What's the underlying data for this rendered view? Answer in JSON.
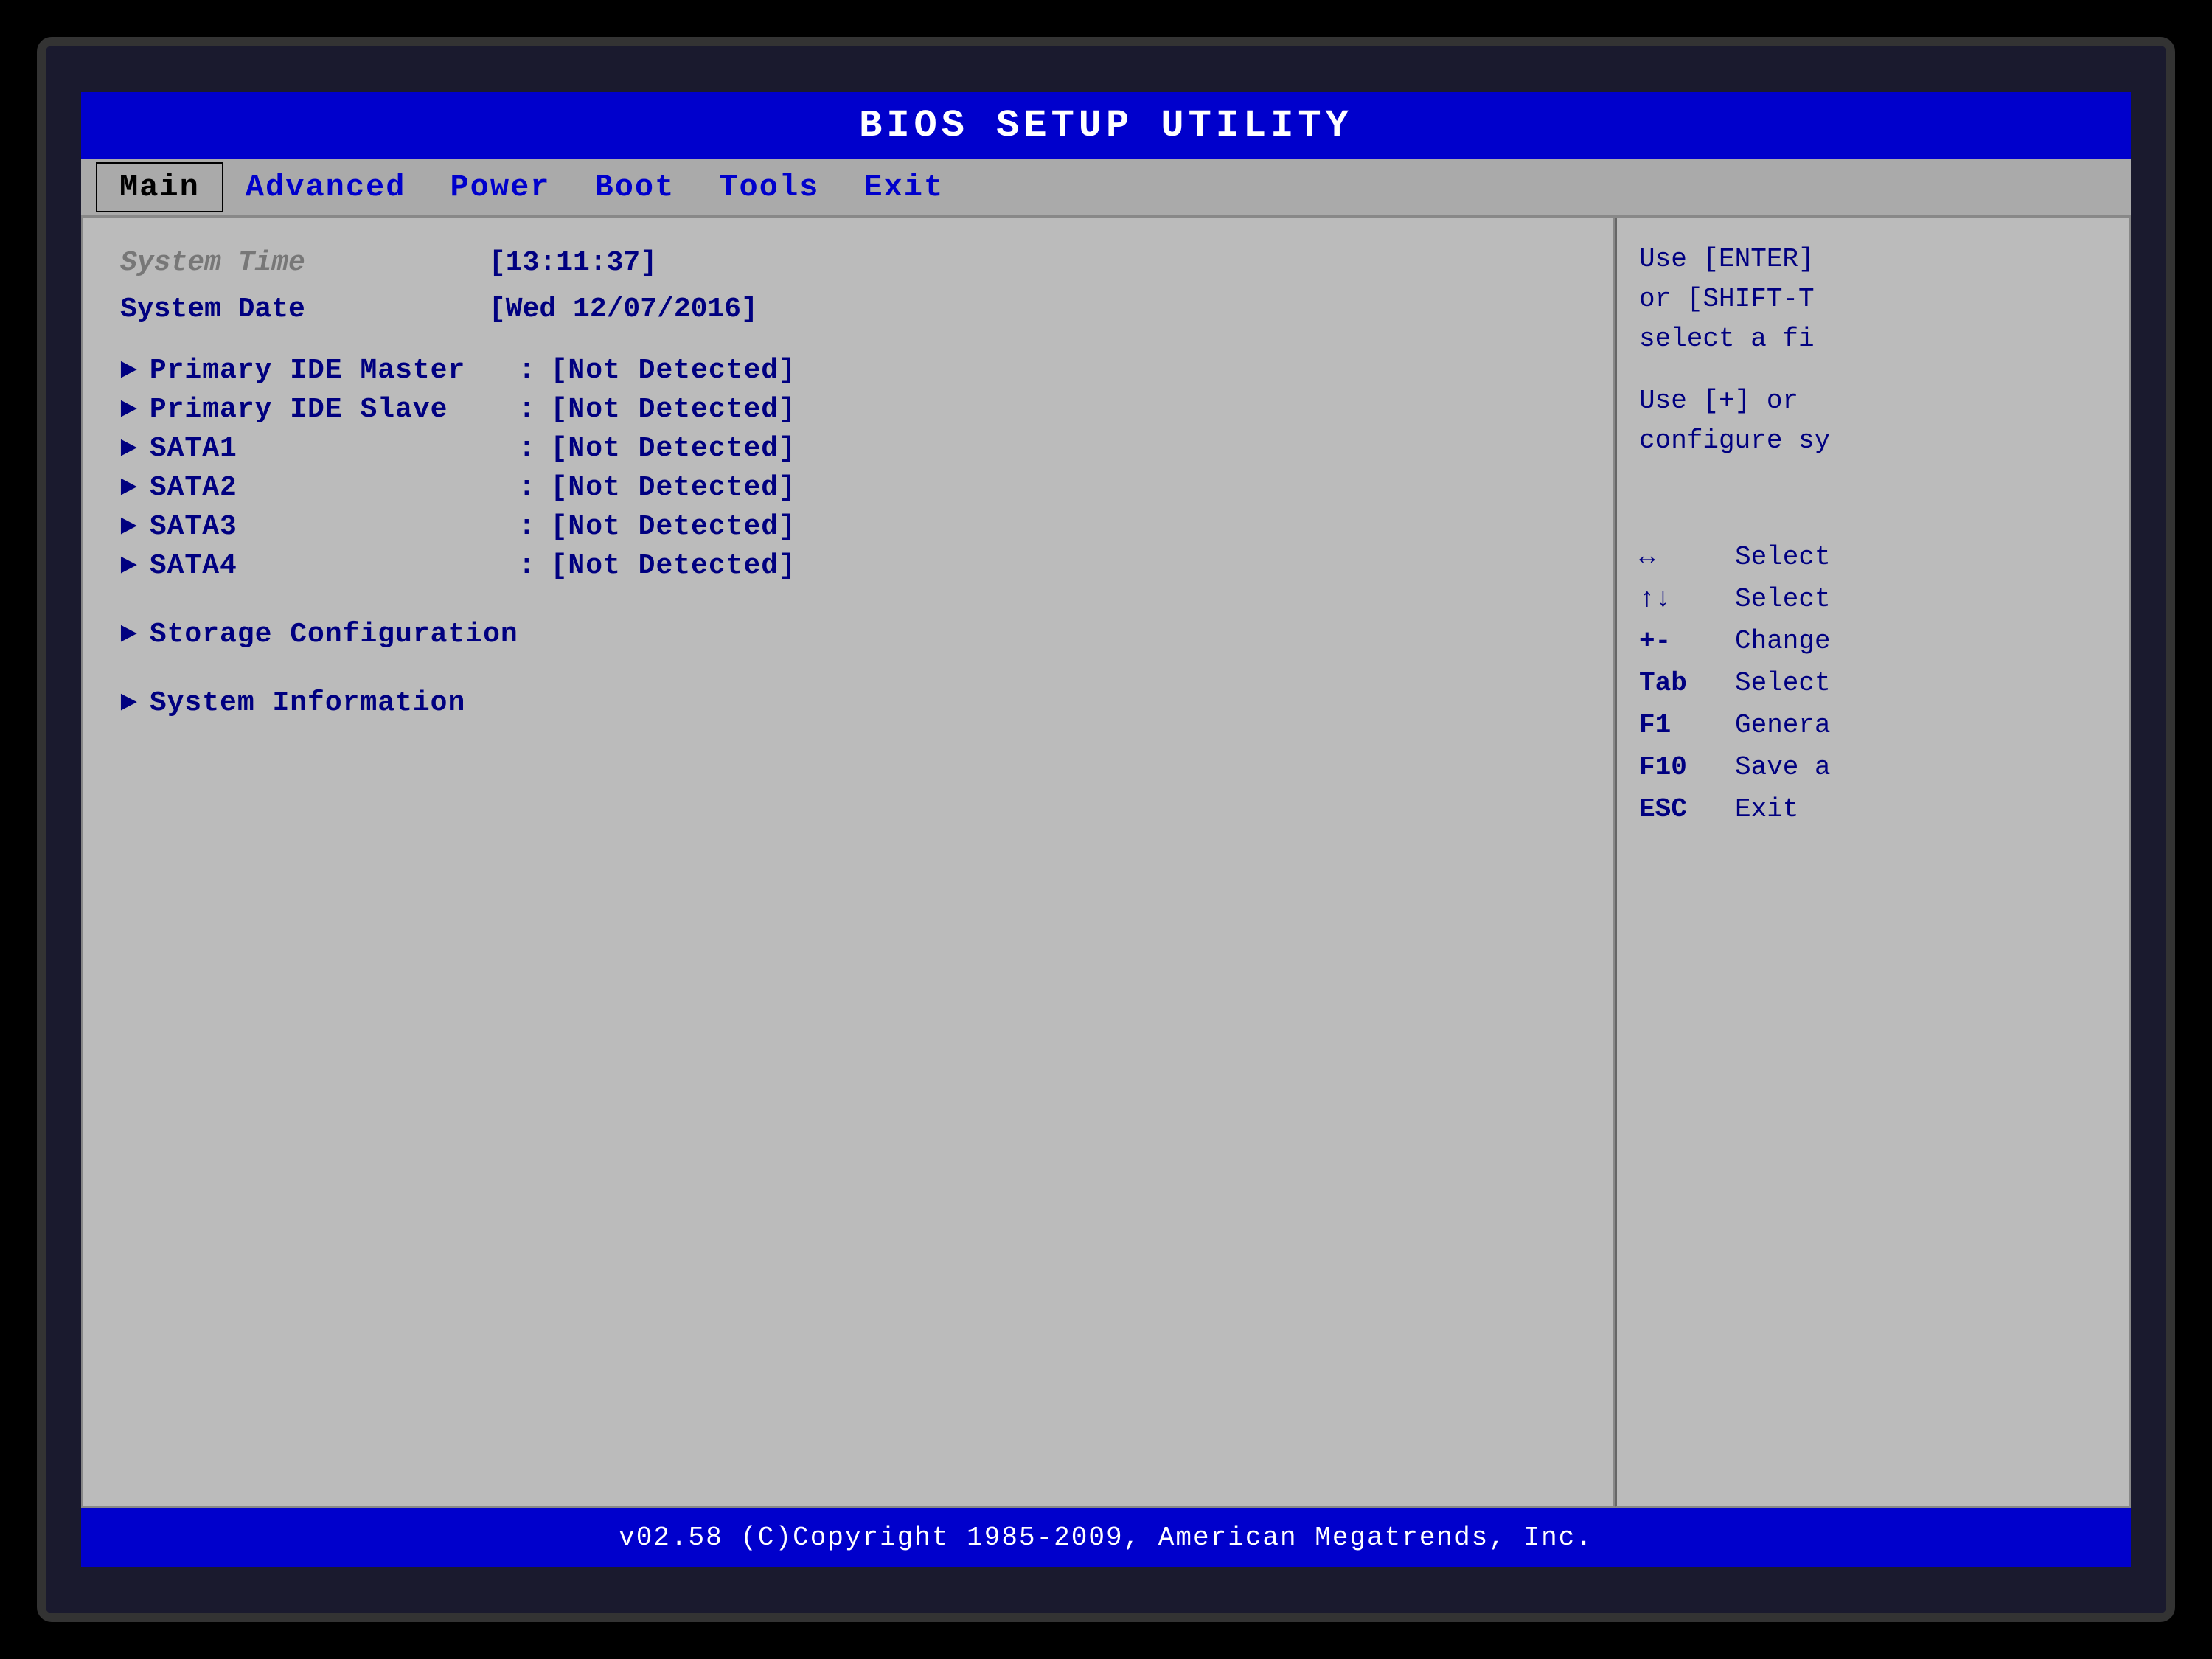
{
  "title_bar": {
    "text": "BIOS  SETUP  UTILITY"
  },
  "nav": {
    "items": [
      {
        "label": "Main",
        "active": true
      },
      {
        "label": "Advanced",
        "active": false
      },
      {
        "label": "Power",
        "active": false
      },
      {
        "label": "Boot",
        "active": false
      },
      {
        "label": "Tools",
        "active": false
      },
      {
        "label": "Exit",
        "active": false
      }
    ]
  },
  "main": {
    "system_time_label": "System Time",
    "system_time_value": "[13:11:37]",
    "system_date_label": "System Date",
    "system_date_value": "[Wed 12/07/2016]",
    "devices": [
      {
        "label": "Primary IDE Master",
        "value": "[Not Detected]"
      },
      {
        "label": "Primary IDE Slave",
        "value": "[Not Detected]"
      },
      {
        "label": "SATA1",
        "value": "[Not Detected]"
      },
      {
        "label": "SATA2",
        "value": "[Not Detected]"
      },
      {
        "label": "SATA3",
        "value": "[Not Detected]"
      },
      {
        "label": "SATA4",
        "value": "[Not Detected]"
      }
    ],
    "storage_config_label": "Storage Configuration",
    "system_info_label": "System Information"
  },
  "help": {
    "line1": "Use [ENTER]",
    "line2": "or [SHIFT-T",
    "line3": "select a fi",
    "line4": "Use [+] or",
    "line5": "configure sy"
  },
  "key_legend": [
    {
      "key": "↔",
      "desc": "Select"
    },
    {
      "key": "↑↓",
      "desc": "Select"
    },
    {
      "key": "+-",
      "desc": "Change"
    },
    {
      "key": "Tab",
      "desc": "Select"
    },
    {
      "key": "F1",
      "desc": "Genera"
    },
    {
      "key": "F10",
      "desc": "Save a"
    },
    {
      "key": "ESC",
      "desc": "Exit"
    }
  ],
  "status_bar": {
    "text": "v02.58  (C)Copyright 1985-2009, American Megatrends, Inc."
  }
}
